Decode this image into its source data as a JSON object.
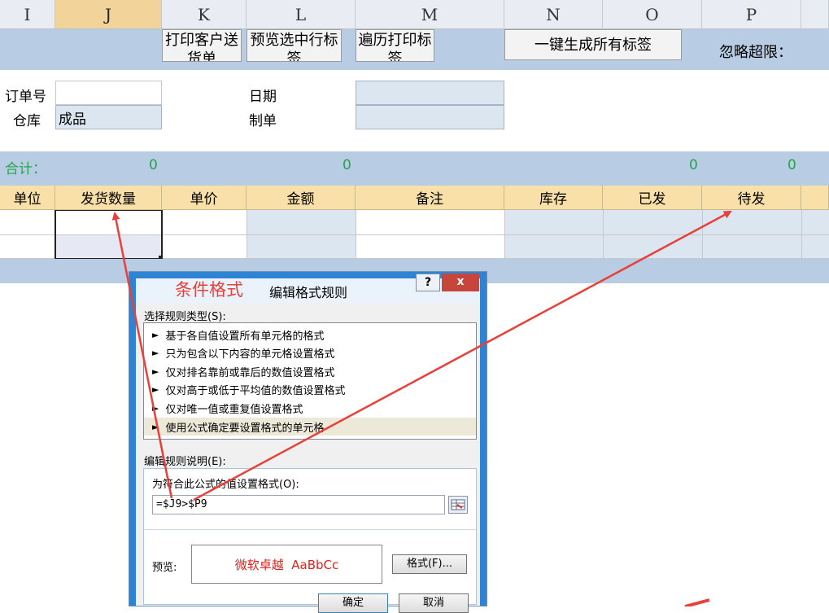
{
  "columns": [
    "I",
    "J",
    "K",
    "L",
    "M",
    "N",
    "O",
    "P"
  ],
  "toolbar": {
    "print_customer": "打印客户送货单",
    "preview_selected": "预览选中行标签",
    "iterate_print": "遍历打印标签",
    "generate_all": "一键生成所有标签",
    "ignore_limit": "忽略超限："
  },
  "form": {
    "order_no_label": "订单号",
    "warehouse_label": "仓库",
    "warehouse_value": "成品",
    "date_label": "日期",
    "maker_label": "制单"
  },
  "totals": {
    "label": "合计：",
    "qty": "0",
    "amount": "0",
    "shipped": "0",
    "pending": "0"
  },
  "table_headers": [
    "单位",
    "发货数量",
    "单价",
    "金额",
    "备注",
    "库存",
    "已发",
    "待发"
  ],
  "annotation": "条件格式",
  "dialog": {
    "title": "编辑格式规则",
    "help": "?",
    "close": "x",
    "select_type_label": "选择规则类型(S):",
    "rule_types": [
      "基于各自值设置所有单元格的格式",
      "只为包含以下内容的单元格设置格式",
      "仅对排名靠前或靠后的数值设置格式",
      "仅对高于或低于平均值的数值设置格式",
      "仅对唯一值或重复值设置格式",
      "使用公式确定要设置格式的单元格"
    ],
    "edit_desc_label": "编辑规则说明(E):",
    "formula_label": "为符合此公式的值设置格式(O):",
    "formula_value": "=$J9>$P9",
    "preview_label": "预览:",
    "preview_text": "微软卓越  AaBbCc",
    "format_button": "格式(F)...",
    "ok_button": "确定",
    "cancel_button": "取消"
  },
  "colors": {
    "header_band": "#b8cce4",
    "table_header": "#f9dfa8",
    "total_green": "#21a64a",
    "annotation_red": "#e8403a",
    "dialog_title": "#2e84d2"
  }
}
